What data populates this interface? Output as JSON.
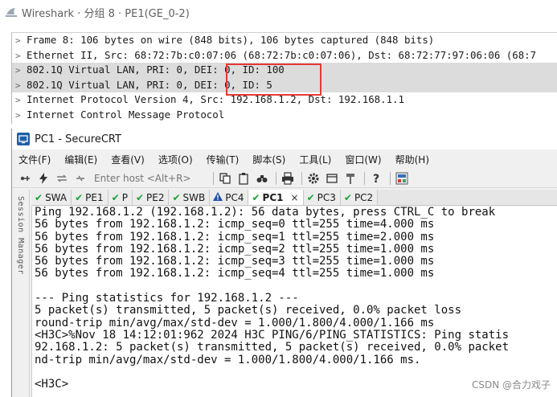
{
  "wireshark": {
    "title": "Wireshark · 分组 8 · PE1(GE_0-2)",
    "rows": [
      {
        "arrow": ">",
        "text": "Frame 8: 106 bytes on wire (848 bits), 106 bytes captured (848 bits)",
        "selected": false
      },
      {
        "arrow": ">",
        "text": "Ethernet II, Src: 68:72:7b:c0:07:06 (68:72:7b:c0:07:06), Dst: 68:72:77:97:06:06 (68:7",
        "selected": false
      },
      {
        "arrow": ">",
        "text": "802.1Q Virtual LAN, PRI: 0, DEI: 0, ID: 100",
        "selected": true
      },
      {
        "arrow": ">",
        "text": "802.1Q Virtual LAN, PRI: 0, DEI: 0, ID: 5",
        "selected": true
      },
      {
        "arrow": ">",
        "text": "Internet Protocol Version 4, Src: 192.168.1.2, Dst: 192.168.1.1",
        "selected": false
      },
      {
        "arrow": ">",
        "text": "Internet Control Message Protocol",
        "selected": false
      }
    ]
  },
  "securecrt": {
    "title": "PC1 - SecureCRT",
    "menu": [
      "文件(F)",
      "编辑(E)",
      "查看(V)",
      "选项(O)",
      "传输(T)",
      "脚本(S)",
      "工具(L)",
      "窗口(W)",
      "帮助(H)"
    ],
    "toolbar": {
      "host_placeholder": "Enter host <Alt+R>"
    },
    "session_manager_label": "Session Manager",
    "tabs": [
      {
        "label": "SWA",
        "status": "ok"
      },
      {
        "label": "PE1",
        "status": "ok"
      },
      {
        "label": "P",
        "status": "ok"
      },
      {
        "label": "PE2",
        "status": "ok"
      },
      {
        "label": "SWB",
        "status": "ok"
      },
      {
        "label": "PC4",
        "status": "warn"
      },
      {
        "label": "PC1",
        "status": "ok",
        "active": true,
        "close": "×"
      },
      {
        "label": "PC3",
        "status": "ok"
      },
      {
        "label": "PC2",
        "status": "ok"
      }
    ],
    "terminal_lines": [
      "Ping 192.168.1.2 (192.168.1.2): 56 data bytes, press CTRL_C to break",
      "56 bytes from 192.168.1.2: icmp_seq=0 ttl=255 time=4.000 ms",
      "56 bytes from 192.168.1.2: icmp_seq=1 ttl=255 time=2.000 ms",
      "56 bytes from 192.168.1.2: icmp_seq=2 ttl=255 time=1.000 ms",
      "56 bytes from 192.168.1.2: icmp_seq=3 ttl=255 time=1.000 ms",
      "56 bytes from 192.168.1.2: icmp_seq=4 ttl=255 time=1.000 ms",
      "",
      "--- Ping statistics for 192.168.1.2 ---",
      "5 packet(s) transmitted, 5 packet(s) received, 0.0% packet loss",
      "round-trip min/avg/max/std-dev = 1.000/1.800/4.000/1.166 ms",
      "<H3C>%Nov 18 14:12:01:962 2024 H3C PING/6/PING_STATISTICS: Ping statis",
      "92.168.1.2: 5 packet(s) transmitted, 5 packet(s) received, 0.0% packet",
      "nd-trip min/avg/max/std-dev = 1.000/1.800/4.000/1.166 ms.",
      "",
      "<H3C>"
    ]
  },
  "watermark": "CSDN @合力戏子"
}
